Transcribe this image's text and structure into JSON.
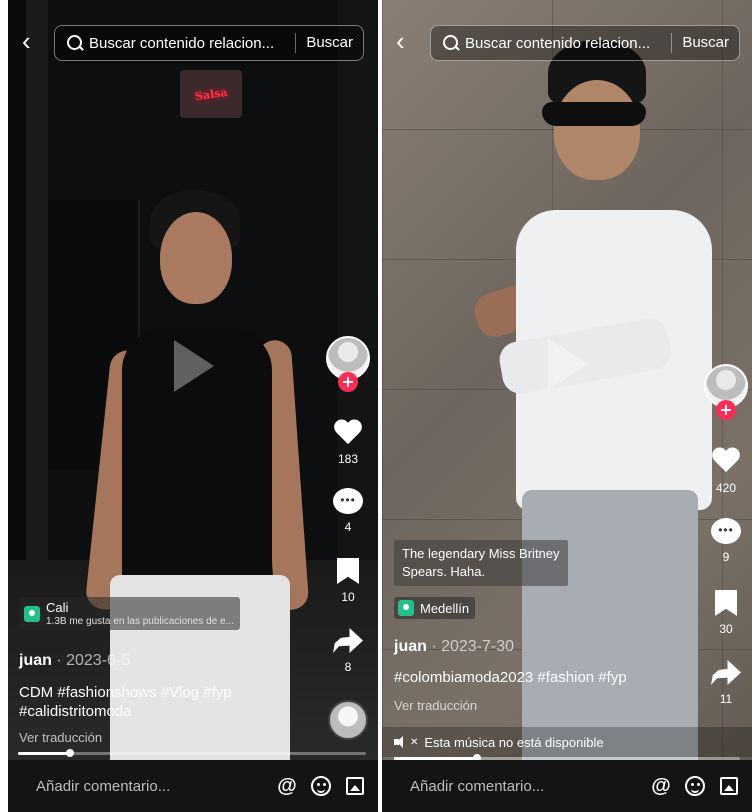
{
  "left": {
    "search": {
      "text": "Buscar contenido relacion...",
      "button": "Buscar"
    },
    "sign_text": "Salsa",
    "location": {
      "name": "Cali",
      "subtitle": "1.3B me gusta en las publicaciones de e..."
    },
    "author": {
      "name": "juan",
      "date": " · 2023-6-5"
    },
    "caption": {
      "line1": "CDM #fashionshows #Vlog #fyp",
      "line2": "#calidistritomoda"
    },
    "translate": "Ver traducción",
    "stats": {
      "likes": "183",
      "comments": "4",
      "saves": "10",
      "shares": "8"
    },
    "progress": 0.15,
    "comment_placeholder": "Añadir comentario...",
    "comment_at": "@"
  },
  "right": {
    "search": {
      "text": "Buscar contenido relacion...",
      "button": "Buscar"
    },
    "quote": {
      "line1": "The legendary Miss Britney",
      "line2": "Spears. Haha."
    },
    "location": {
      "name": "Medellín"
    },
    "author": {
      "name": "juan",
      "date": " · 2023-7-30"
    },
    "caption": {
      "line1": "#colombiamoda2023 #fashion #fyp"
    },
    "translate": "Ver traducción",
    "music_unavailable": "Esta música no está disponible",
    "stats": {
      "likes": "420",
      "comments": "9",
      "saves": "30",
      "shares": "11"
    },
    "progress": 0.24,
    "comment_placeholder": "Añadir comentario...",
    "comment_at": "@"
  },
  "colors": {
    "follow": "#fe2c55",
    "location_pin": "#22c08a",
    "bar_bg": "#141414"
  }
}
